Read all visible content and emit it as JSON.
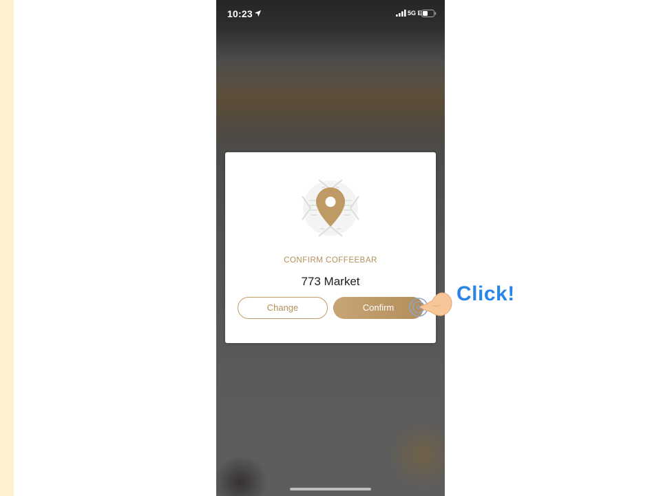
{
  "status_bar": {
    "time": "10:23",
    "network": "5G E",
    "icons": [
      "location-arrow-icon",
      "signal-bars-icon",
      "battery-icon"
    ]
  },
  "dialog": {
    "icon": "map-pin-icon",
    "title": "CONFIRM COFFEEBAR",
    "location": "773 Market",
    "change_label": "Change",
    "confirm_label": "Confirm"
  },
  "annotation": {
    "icon": "pointing-hand-icon",
    "label": "Click!"
  },
  "colors": {
    "accent": "#b38e5b",
    "annotation": "#2a86e6",
    "left_strip": "#fff1cf"
  }
}
